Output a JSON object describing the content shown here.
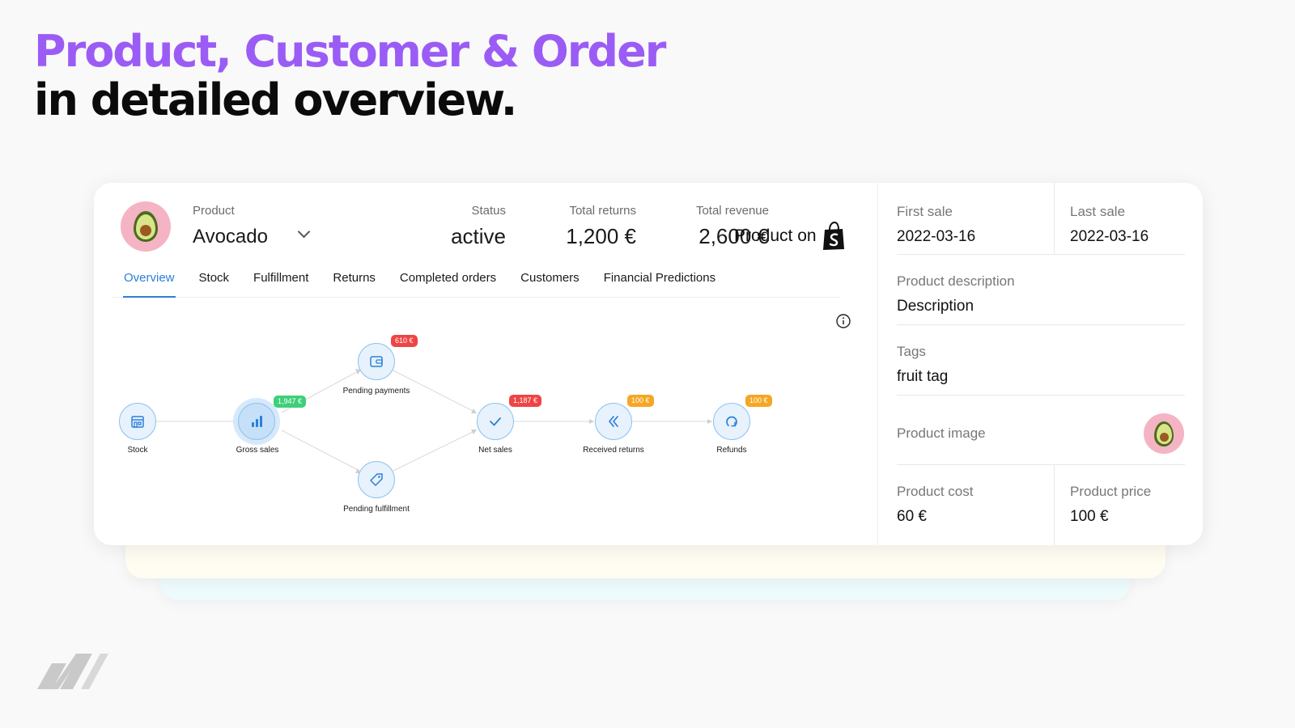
{
  "headline": {
    "line1": "Product, Customer & Order",
    "line2": "in detailed overview."
  },
  "header": {
    "product_label": "Product",
    "product_value": "Avocado",
    "status_label": "Status",
    "status_value": "active",
    "returns_label": "Total returns",
    "returns_value": "1,200 €",
    "revenue_label": "Total revenue",
    "revenue_value": "2,600 €",
    "product_on_label": "Product on"
  },
  "tabs": [
    {
      "label": "Overview"
    },
    {
      "label": "Stock"
    },
    {
      "label": "Fulfillment"
    },
    {
      "label": "Returns"
    },
    {
      "label": "Completed orders"
    },
    {
      "label": "Customers"
    },
    {
      "label": "Financial Predictions"
    }
  ],
  "flow": {
    "nodes": {
      "stock": {
        "label": "Stock"
      },
      "gross_sales": {
        "label": "Gross sales",
        "badge": "1,947 €"
      },
      "pending_payments": {
        "label": "Pending payments",
        "badge": "610 €"
      },
      "pending_fulfillment": {
        "label": "Pending fulfillment"
      },
      "net_sales": {
        "label": "Net sales",
        "badge": "1,187 €"
      },
      "received_returns": {
        "label": "Received returns",
        "badge": "100 €"
      },
      "refunds": {
        "label": "Refunds",
        "badge": "100 €"
      }
    }
  },
  "side": {
    "first_sale_label": "First sale",
    "first_sale_value": "2022-03-16",
    "last_sale_label": "Last sale",
    "last_sale_value": "2022-03-16",
    "description_label": "Product description",
    "description_value": "Description",
    "tags_label": "Tags",
    "tags_value": "fruit tag",
    "image_label": "Product image",
    "cost_label": "Product cost",
    "cost_value": "60 €",
    "price_label": "Product price",
    "price_value": "100 €"
  },
  "colors": {
    "accent_purple": "#9b5cf5",
    "tab_active": "#2b7fd9",
    "badge_red": "#ef4444",
    "badge_green": "#3ecf7a",
    "badge_orange": "#f5a623"
  }
}
